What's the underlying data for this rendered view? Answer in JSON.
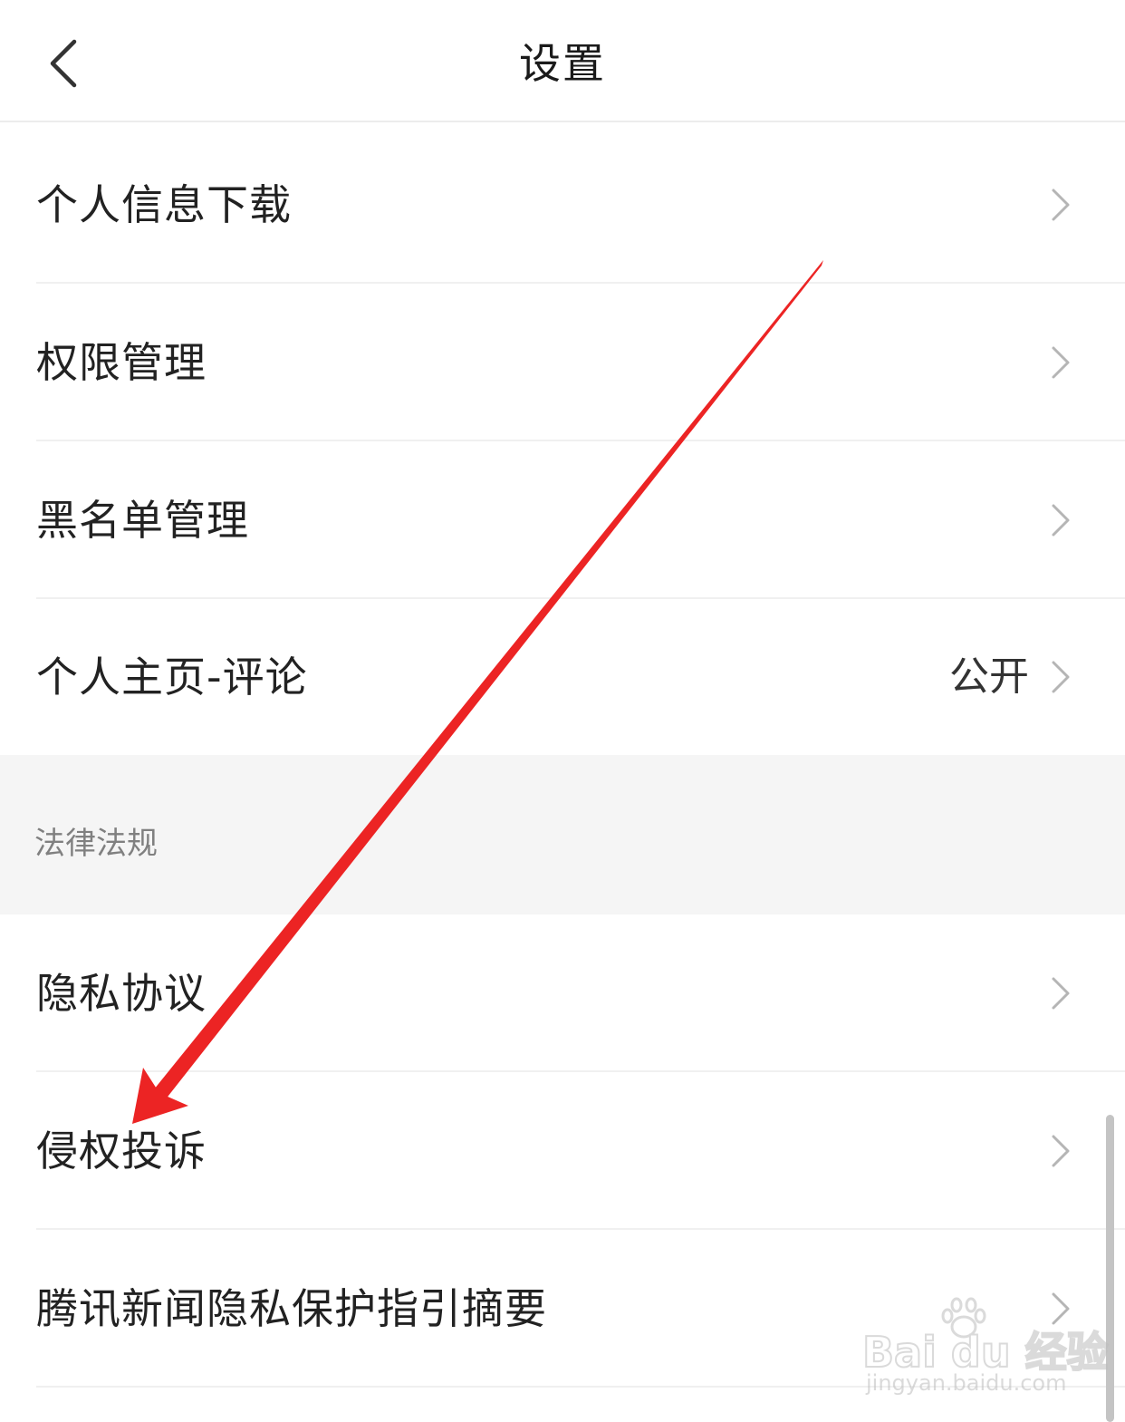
{
  "header": {
    "title": "设置",
    "back_icon": "chevron-left-icon"
  },
  "rows_top": [
    {
      "label": "个人信息下载",
      "value": ""
    },
    {
      "label": "权限管理",
      "value": ""
    },
    {
      "label": "黑名单管理",
      "value": ""
    },
    {
      "label": "个人主页-评论",
      "value": "公开"
    }
  ],
  "section": {
    "title": "法律法规"
  },
  "rows_legal": [
    {
      "label": "隐私协议",
      "value": ""
    },
    {
      "label": "侵权投诉",
      "value": ""
    },
    {
      "label": "腾讯新闻隐私保护指引摘要",
      "value": ""
    }
  ],
  "annotation": {
    "color": "#ec2424",
    "icon": "red-arrow-annotation"
  },
  "watermark": {
    "brand": "Bai du 经验",
    "url": "jingyan.baidu.com"
  },
  "colors": {
    "background": "#ffffff",
    "section_background": "#f5f5f5",
    "divider": "#f0f0f0",
    "chevron": "#b5b5b5",
    "annotation": "#ec2424"
  }
}
